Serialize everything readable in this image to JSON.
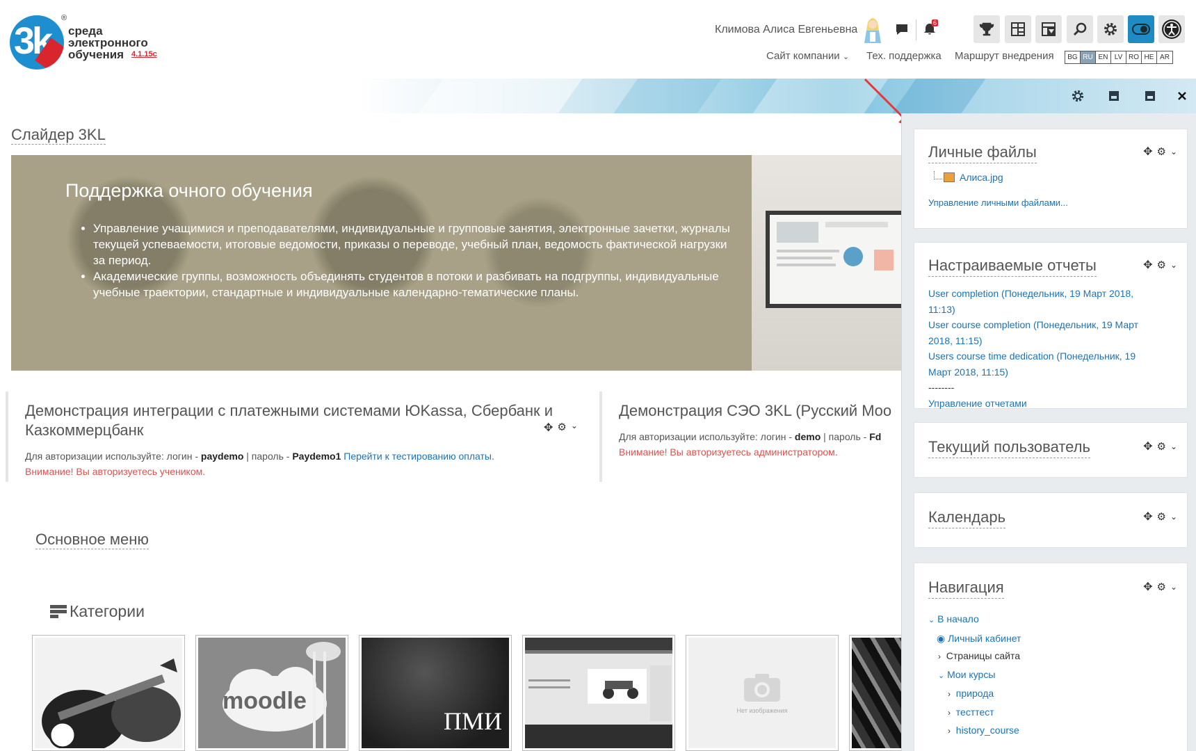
{
  "logo": {
    "line1": "среда",
    "line2": "электронного",
    "line3": "обучения",
    "version": "4.1.15c",
    "reg": "®",
    "k": "3k"
  },
  "header": {
    "user_name": "Климова Алиса Евгеньевна",
    "notif_count": "6",
    "nav": [
      "Сайт компании",
      "Тех. поддержка",
      "Маршрут внедрения"
    ],
    "languages": [
      "BG",
      "RU",
      "EN",
      "LV",
      "RO",
      "HE",
      "AR"
    ],
    "selected_language": "RU",
    "accent_color": "#1e8bc3"
  },
  "main": {
    "slider_title": "Слайдер 3KL",
    "slider": {
      "heading": "Поддержка очного обучения",
      "bullets": [
        "Управление учащимися и преподавателями, индивидуальные и групповые занятия, электронные зачетки, журналы текущей успеваемости, итоговые ведомости, приказы о переводе, учебный план, ведомость фактической нагрузки за период.",
        "Академические группы, возможность объединять студентов в потоки и разбивать на подгруппы, индивидуальные учебные траектории, стандартные и индивидуальные календарно-тематические планы."
      ]
    },
    "demo1": {
      "title": "Демонстрация интеграции с платежными системами ЮKassa, Сбербанк и Казкоммерцбанк",
      "prefix": "Для авторизации используйте: логин - ",
      "login": "paydemo",
      "mid": " | пароль - ",
      "password": "Paydemo1",
      "link": " Перейти к тестированию оплаты.",
      "warning": "Внимание! Вы авторизуетесь учеником."
    },
    "demo2": {
      "title": "Демонстрация СЭО 3KL (Русский Moo",
      "prefix": "Для авторизации используйте: логин - ",
      "login": "demo",
      "mid": " | пароль - ",
      "password": "Fd",
      "warning": "Внимание! Вы авторизуетесь администратором."
    },
    "main_menu_title": "Основное меню",
    "categories_title": "Категории",
    "tile_texts": {
      "moodle": "moodle",
      "pmi": "ПМИ",
      "no_image": "Нет изображения"
    }
  },
  "drawer": {
    "personal_files": {
      "title": "Личные файлы",
      "file": "Алиса.jpg",
      "manage": "Управление личными файлами..."
    },
    "reports": {
      "title": "Настраиваемые отчеты",
      "items": [
        "User completion (Понедельник, 19 Март 2018, 11:13)",
        "User course completion (Понедельник, 19 Март 2018, 11:15)",
        "Users course time dedication (Понедельник, 19 Март 2018, 11:15)"
      ],
      "separator": "--------",
      "manage": "Управление отчетами"
    },
    "current_user": {
      "title": "Текущий пользователь"
    },
    "calendar": {
      "title": "Календарь"
    },
    "navigation": {
      "title": "Навигация",
      "home": "В начало",
      "dashboard": "Личный кабинет",
      "site_pages": "Страницы сайта",
      "my_courses": "Мои курсы",
      "courses": [
        "природа",
        "тесттест",
        "history_course"
      ]
    }
  }
}
